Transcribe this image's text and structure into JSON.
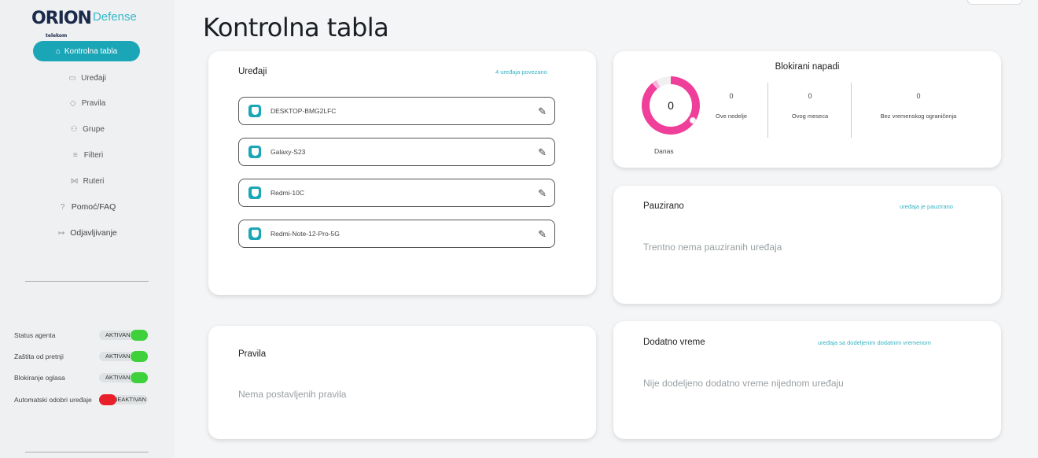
{
  "logo": {
    "brand": "ORION",
    "sub": "telekom",
    "product": "Defense"
  },
  "page_title": "Kontrolna tabla",
  "sidebar": {
    "active": {
      "icon": "home-icon",
      "label": "Kontrolna tabla"
    },
    "items": [
      {
        "icon": "devices-icon",
        "label": "Uređaji"
      },
      {
        "icon": "shield-icon",
        "label": "Pravila"
      },
      {
        "icon": "group-icon",
        "label": "Grupe"
      },
      {
        "icon": "filter-icon",
        "label": "Filteri"
      },
      {
        "icon": "router-icon",
        "label": "Ruteri"
      },
      {
        "icon": "help-icon",
        "label": "Pomoć/FAQ"
      },
      {
        "icon": "logout-icon",
        "label": "Odjavljivanje"
      }
    ],
    "status": [
      {
        "label": "Status agenta",
        "value": "AKTIVAN",
        "on": true
      },
      {
        "label": "Zaštita od pretnji",
        "value": "AKTIVAN",
        "on": true
      },
      {
        "label": "Blokiranje oglasa",
        "value": "AKTIVAN",
        "on": true
      },
      {
        "label": "Automatski odobri uređaje",
        "value": "NEAKTIVAN",
        "on": false
      }
    ]
  },
  "devices_card": {
    "title": "Uređaji",
    "link": "4 uređaja povezano",
    "devices": [
      "DESKTOP-BMG2LFC",
      "Galaxy-S23",
      "Redmi-10C",
      "Redmi-Note-12-Pro-5G"
    ]
  },
  "blocked_card": {
    "title": "Blokirani napadi",
    "today_value": "0",
    "today_label": "Danas",
    "stats": [
      {
        "value": "0",
        "label": "Ove nedelje"
      },
      {
        "value": "0",
        "label": "Ovog meseca"
      },
      {
        "value": "0",
        "label": "Bez vremenskog ograničenja"
      }
    ]
  },
  "paused_card": {
    "title": "Pauzirano",
    "link": "uređaja je pauzirano",
    "empty": "Trentno nema pauziranih uređaja"
  },
  "rules_card": {
    "title": "Pravila",
    "empty": "Nema postavljenih pravila"
  },
  "extra_card": {
    "title": "Dodatno vreme",
    "link": "uređaja sa dodeljenim dodatnim vremenom",
    "empty": "Nije dodeljeno dodatno vreme nijednom uređaju"
  },
  "colors": {
    "accent": "#1aa6b7",
    "ring": "#f03e9b",
    "on": "#3fd13c",
    "off": "#e8202a"
  }
}
